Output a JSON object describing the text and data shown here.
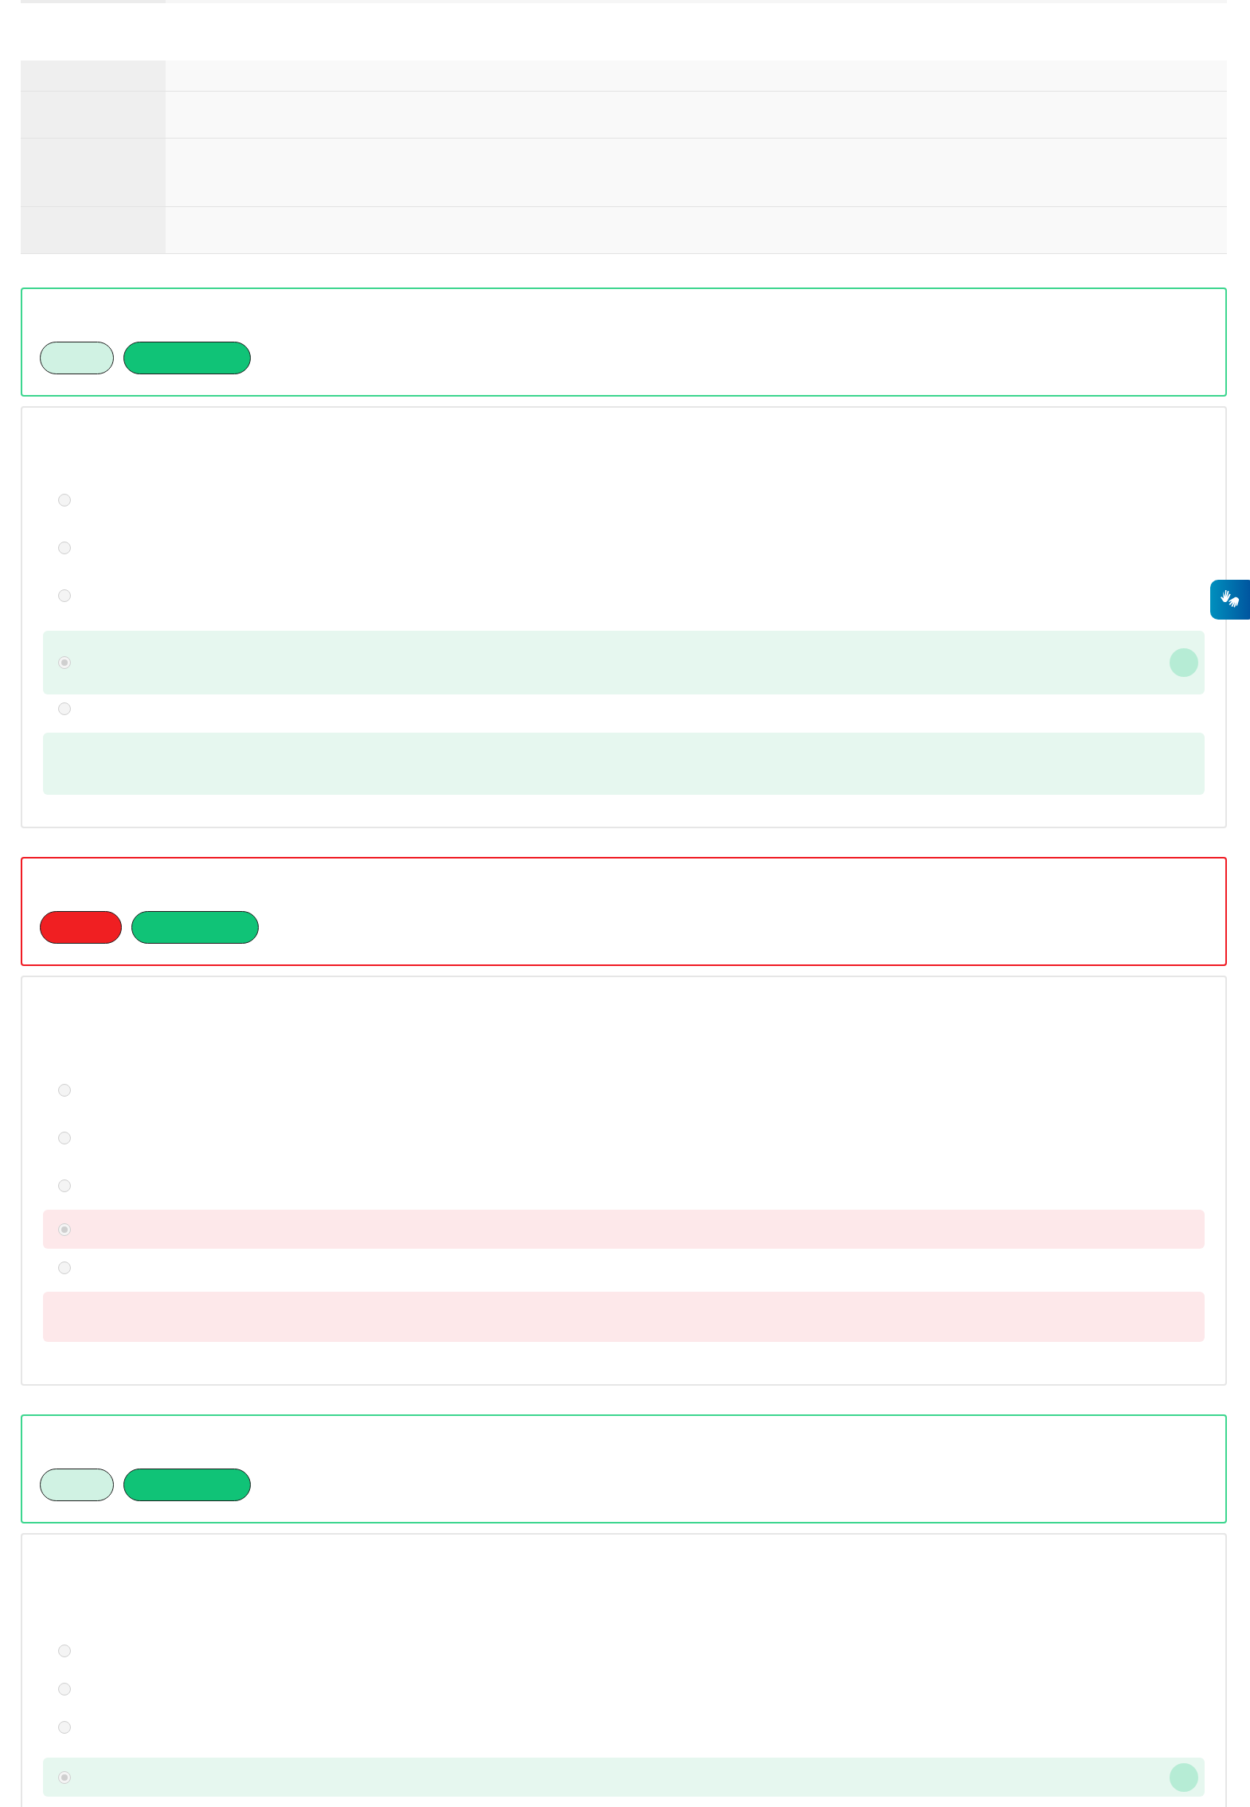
{
  "top_bar": {
    "kind": "tabs"
  },
  "info_table": {
    "rows": [
      {
        "kind": "single"
      },
      {
        "kind": "double"
      },
      {
        "kind": "triple"
      },
      {
        "kind": "double"
      }
    ]
  },
  "questions": [
    {
      "correct": true,
      "options": [
        {
          "selected": false
        },
        {
          "selected": false
        },
        {
          "selected": false
        },
        {
          "selected": true
        },
        {
          "selected": false
        }
      ],
      "explanation": {
        "kind": "panel"
      }
    },
    {
      "correct": false,
      "options": [
        {
          "selected": false
        },
        {
          "selected": false
        },
        {
          "selected": false
        },
        {
          "selected": true
        },
        {
          "selected": false
        }
      ],
      "explanation": {
        "kind": "panel"
      }
    },
    {
      "correct": true,
      "options": [
        {
          "selected": false
        },
        {
          "selected": false
        },
        {
          "selected": false
        },
        {
          "selected": true
        }
      ]
    }
  ],
  "accessibility_button": {
    "kind": "sign_language"
  }
}
